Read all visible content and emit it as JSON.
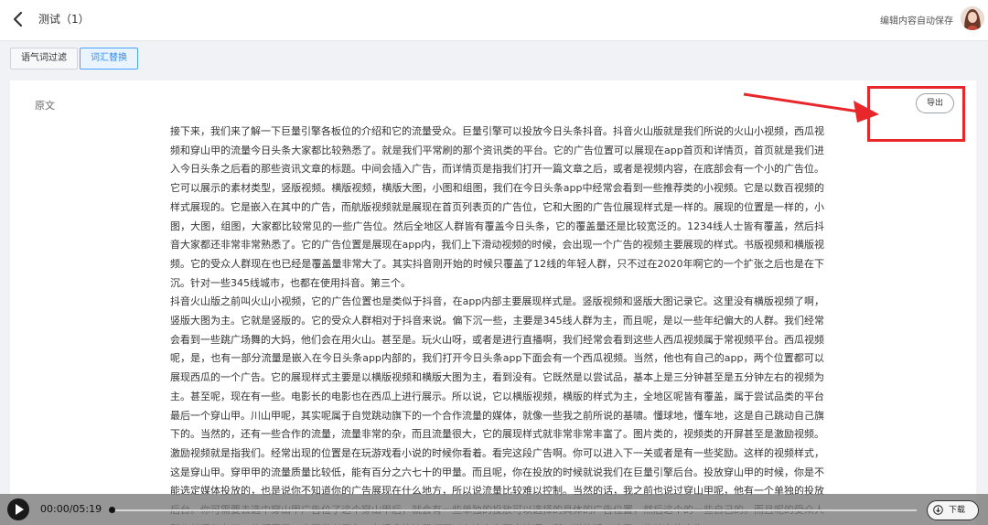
{
  "header": {
    "title": "测试（1）",
    "autosave_text": "编辑内容自动保存"
  },
  "tabs": [
    {
      "label": "语气词过滤",
      "active": false
    },
    {
      "label": "词汇替换",
      "active": true
    }
  ],
  "panel": {
    "section_label": "原文",
    "export_label": "导出",
    "paragraphs": [
      "接下来，我们来了解一下巨量引擎各板位的介绍和它的流量受众。巨量引擎可以投放今日头条抖音。抖音火山版就是我们所说的火山小视频，西瓜视频和穿山甲的流量今日头条大家都比较熟悉了。就是我们平常刷的那个资讯类的平台。它的广告位置可以展现在app首页和详情页，首页就是我们进入今日头条之后看的那些资讯文章的标题。中间会插入广告，而详情页是指我们打开一篇文章之后，或者是视频内容，在底部会有一个小的广告位。它可以展示的素材类型，竖版视频。横版视频，横版大图，小图和组图，我们在今日头条app中经常会看到一些推荐类的小视频。它是以数百视频的样式展现的。它是嵌入在其中的广告，而航版视频就是展现在首页列表页的广告位，它和大图的广告位展现样式是一样的。展现的位置是一样的，小图，大图，组图，大家都比较常见的一些广告位。然后全地区人群皆有覆盖今日头条，它的覆盖量还是比较宽泛的。1234线人士皆有覆盖，然后抖音大家都还非常非常熟悉了。它的广告位置是展现在app内，我们上下滑动视频的时候，会出现一个广告的视频主要展现的样式。书版视频和横版视频。它的受众人群现在也已经是覆盖量非常大了。其实抖音刚开始的时候只覆盖了12线的年轻人群，只不过在2020年啊它的一个扩张之后也是在下沉。针对一些345线城市，也都在使用抖音。第三个。",
      "抖音火山版之前叫火山小视频，它的广告位置也是类似于抖音，在app内部主要展现样式是。竖版视频和竖版大图记录它。这里没有横版视频了啊，竖版大图为主。它就是竖版的。它的受众人群相对于抖音来说。偏下沉一些，主要是345线人群为主，而且呢，是以一些年纪偏大的人群。我们经常会看到一些跳广场舞的大妈，他们会在用火山。甚至是。玩火山呀，或者是进行直播啊，我们经常会看到这些人西瓜视频属于常视频平台。西瓜视频呢，是，也有一部分流量是嵌入在今日头条app内部的，我们打开今日头条app下面会有一个西瓜视频。当然，他也有自己的app，两个位置都可以展现西瓜的一个广告。它的展现样式主要是以横版视频和横版大图为主，看到没有。它既然是以尝试品，基本上是三分钟甚至是五分钟左右的视频为主。甚至呢，现在有一些。电影长的电影也在西瓜上进行展示。所以说，它以横版视频，横版的样式为主，全地区呢皆有覆盖，属于尝试品类的平台最后一个穿山甲。川山甲呢，其实呢属于自觉跳动旗下的一个合作流量的媒体，就像一些我之前所说的基啸。懂球地，懂车地，这是自己跳动自己旗下的。当然的，还有一些合作的流量，流量非常的杂，而且流量很大，它的展现样式就非常非常丰富了。图片类的，视频类的开屏甚至是激励视频。",
      "激励视频就是指我们。经常出现的位置是在玩游戏看小说的时候你看着。看完这段广告啊。你可以进入下一关或者是有一些奖励。这样的视频样式，这是穿山甲。穿甲甲的流量质量比较低，能有百分之六七十的甲量。而且呢，你在投放的时候就说我们在巨量引擎后台。投放穿山甲的时候，你是不能选定媒体投放的，也是说你不知道你的广告展现在什么地方，所以说流量比较难以控制。当然的话，我之前也说过穿山甲呢，他有一个单独的投放后台。你可需要去选中穿山甲广告位了这个穿山甲后，就会有一些单独的投放可以选择的具体的广告位置，然后这个的一些自己的。而且呢的受众人群也就很复杂了，他们属于一个开发者平台，有很多的流量都可以在这个上面去挖掘。所以说的话，这是一些其它的广告。"
    ]
  },
  "player": {
    "time": "00:00/05:19",
    "progress": 0.0,
    "download_label": "下载"
  },
  "annotation_color": "#e8272b"
}
